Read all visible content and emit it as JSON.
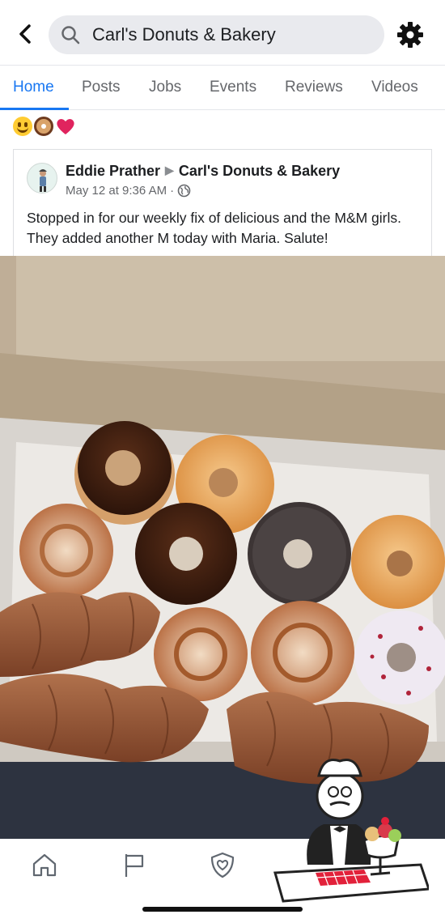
{
  "search": {
    "query": "Carl's Donuts & Bakery"
  },
  "tabs": [
    {
      "label": "Home",
      "active": true
    },
    {
      "label": "Posts"
    },
    {
      "label": "Jobs"
    },
    {
      "label": "Events"
    },
    {
      "label": "Reviews"
    },
    {
      "label": "Videos"
    }
  ],
  "post": {
    "author": "Eddie Prather",
    "page": "Carl's Donuts & Bakery",
    "timestamp": "May 12 at 9:36 AM",
    "privacy_icon": "globe-icon",
    "text": "Stopped in for our weekly fix of delicious and the M&M girls.  They added another M today with Maria.  Salute!",
    "photo_subject": "box of assorted donuts"
  },
  "emojis": [
    "smiley-emoji",
    "donut-emoji",
    "heart-emoji"
  ],
  "bottom_nav": [
    "home-icon",
    "flag-icon",
    "shield-heart-icon"
  ],
  "colors": {
    "accent": "#1877f2",
    "muted": "#65676b",
    "search_bg": "#e9eaee"
  }
}
